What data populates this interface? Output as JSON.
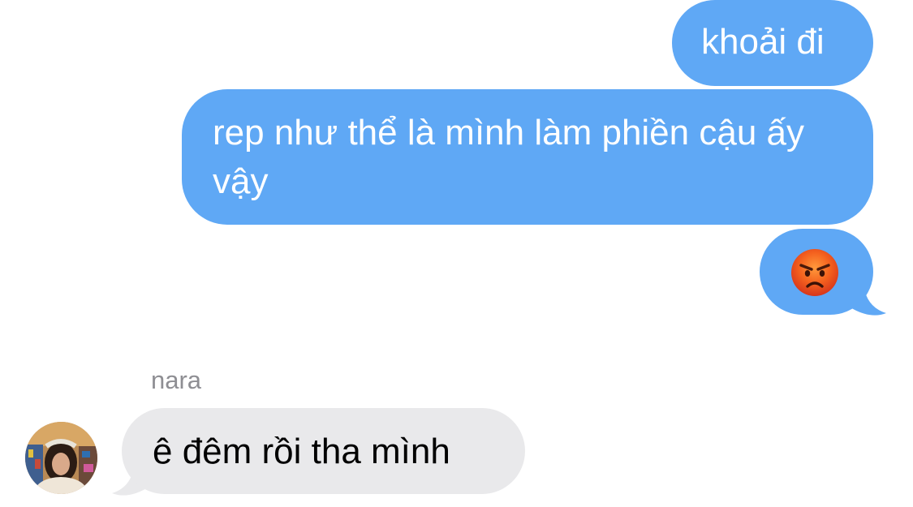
{
  "messages": {
    "sent": [
      {
        "text": "khoải đi"
      },
      {
        "text": "rep như thể là mình làm phiền cậu ấy vậy"
      },
      {
        "emoji": "pouting-face-emoji"
      }
    ],
    "received": {
      "sender_name": "nara",
      "avatar": "contact-avatar-photo",
      "items": [
        {
          "text": "ê đêm rồi tha mình"
        }
      ]
    }
  },
  "colors": {
    "sent_bubble": "#5fa8f5",
    "received_bubble": "#e9e9eb",
    "sender_name": "#8e8e93",
    "background": "#ffffff"
  }
}
